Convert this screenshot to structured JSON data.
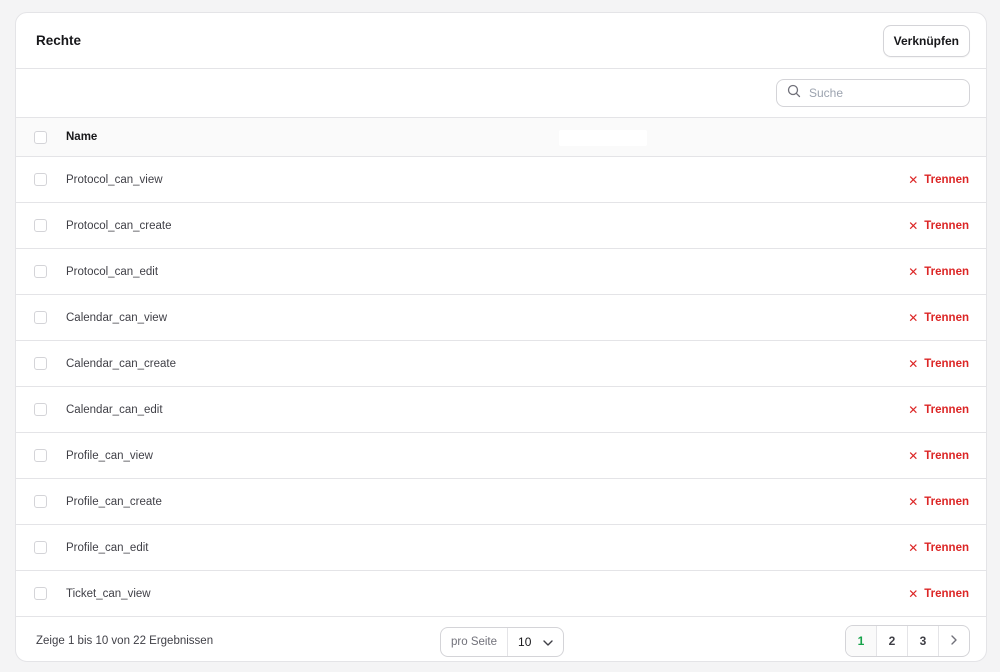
{
  "header": {
    "title": "Rechte",
    "attach_label": "Verknüpfen"
  },
  "search": {
    "placeholder": "Suche"
  },
  "table": {
    "column_name": "Name",
    "rows": [
      {
        "name": "Protocol_can_view",
        "action": "Trennen"
      },
      {
        "name": "Protocol_can_create",
        "action": "Trennen"
      },
      {
        "name": "Protocol_can_edit",
        "action": "Trennen"
      },
      {
        "name": "Calendar_can_view",
        "action": "Trennen"
      },
      {
        "name": "Calendar_can_create",
        "action": "Trennen"
      },
      {
        "name": "Calendar_can_edit",
        "action": "Trennen"
      },
      {
        "name": "Profile_can_view",
        "action": "Trennen"
      },
      {
        "name": "Profile_can_create",
        "action": "Trennen"
      },
      {
        "name": "Profile_can_edit",
        "action": "Trennen"
      },
      {
        "name": "Ticket_can_view",
        "action": "Trennen"
      }
    ]
  },
  "footer": {
    "summary": "Zeige 1 bis 10 von 22 Ergebnissen",
    "per_page_label": "pro Seite",
    "per_page_value": "10",
    "pages": [
      "1",
      "2",
      "3"
    ],
    "active_page": "1"
  },
  "colors": {
    "danger": "#dc2626",
    "active_page": "#16a34a",
    "border": "#e4e4e7"
  }
}
